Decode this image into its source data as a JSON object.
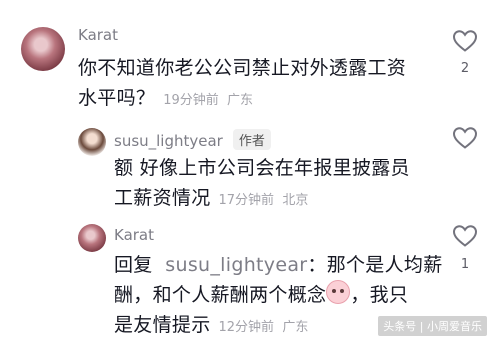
{
  "comments": [
    {
      "author": "Karat",
      "line1": "你不知道你老公公司禁止对外透露工资",
      "line2": "水平吗？",
      "time": "19分钟前",
      "location": "广东",
      "likes": "2"
    },
    {
      "author": "susu_lightyear",
      "badge": "作者",
      "line1": "额 好像上市公司会在年报里披露员",
      "line2": "工薪资情况",
      "time": "17分钟前",
      "location": "北京",
      "likes": ""
    },
    {
      "author": "Karat",
      "reply_prefix": "回复",
      "reply_to": "susu_lightyear",
      "line1_rest": "：那个是人均薪",
      "line2": "酬，和个人薪酬两个概念",
      "emoji": "crying-face-emoji",
      "line2_end": "，我只",
      "line3": "是友情提示",
      "time": "12分钟前",
      "location": "广东",
      "likes": "1"
    }
  ],
  "watermark": "头条号 | 小周爱音乐",
  "colors": {
    "text": "#161823",
    "muted": "#a3a3aa",
    "author": "#7d7d86"
  },
  "icons": [
    "heart-outline-icon"
  ]
}
